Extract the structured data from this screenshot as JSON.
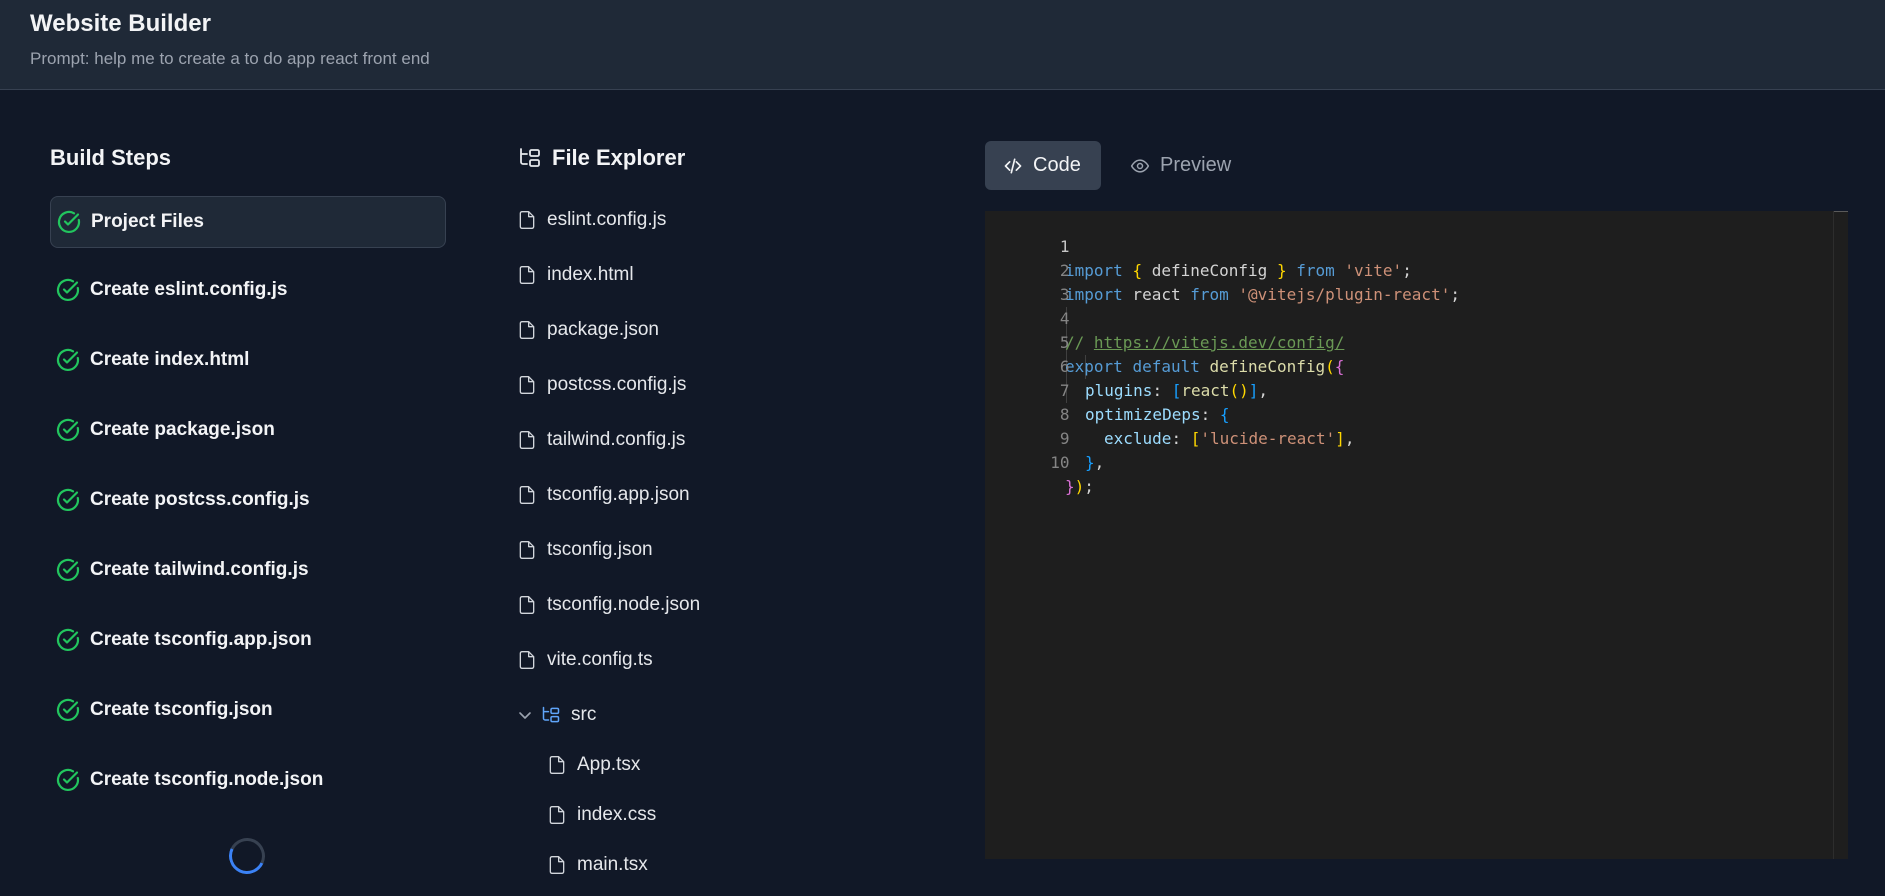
{
  "header": {
    "title": "Website Builder",
    "prompt": "Prompt: help me to create a to do app react front end"
  },
  "build_steps": {
    "title": "Build Steps",
    "items": [
      {
        "label": "Project Files",
        "status": "done",
        "active": true
      },
      {
        "label": "Create eslint.config.js",
        "status": "done"
      },
      {
        "label": "Create index.html",
        "status": "done"
      },
      {
        "label": "Create package.json",
        "status": "done"
      },
      {
        "label": "Create postcss.config.js",
        "status": "done"
      },
      {
        "label": "Create tailwind.config.js",
        "status": "done"
      },
      {
        "label": "Create tsconfig.app.json",
        "status": "done"
      },
      {
        "label": "Create tsconfig.json",
        "status": "done"
      },
      {
        "label": "Create tsconfig.node.json",
        "status": "done"
      }
    ]
  },
  "file_explorer": {
    "title": "File Explorer",
    "files": [
      "eslint.config.js",
      "index.html",
      "package.json",
      "postcss.config.js",
      "tailwind.config.js",
      "tsconfig.app.json",
      "tsconfig.json",
      "tsconfig.node.json",
      "vite.config.ts"
    ],
    "folder": {
      "name": "src",
      "expanded": true,
      "files": [
        "App.tsx",
        "index.css",
        "main.tsx"
      ]
    }
  },
  "tabs": {
    "code_label": "Code",
    "preview_label": "Preview",
    "active": "code"
  },
  "editor": {
    "current_line": 1,
    "lines": [
      {
        "n": "1",
        "t1": "import",
        "t2": " ",
        "t3": "{",
        "t4": " defineConfig ",
        "t5": "}",
        "t6": " ",
        "t7": "from",
        "t8": " ",
        "t9": "'vite'",
        "t10": ";"
      },
      {
        "n": "2",
        "t1": "import",
        "t2": " react ",
        "t3": "from",
        "t4": " ",
        "t5": "'@vitejs/plugin-react'",
        "t6": ";"
      },
      {
        "n": "3"
      },
      {
        "n": "4",
        "t1": "// ",
        "t2": "https://vitejs.dev/config/"
      },
      {
        "n": "5",
        "t1": "export",
        "t2": " ",
        "t3": "default",
        "t4": " ",
        "t5": "defineConfig",
        "t6": "(",
        "t7": "{"
      },
      {
        "n": "6",
        "t1": "plugins",
        "t2": ": ",
        "t3": "[",
        "t4": "react",
        "t5": "()",
        "t6": "]",
        "t7": ","
      },
      {
        "n": "7",
        "t1": "optimizeDeps",
        "t2": ": ",
        "t3": "{"
      },
      {
        "n": "8",
        "t1": "exclude",
        "t2": ": ",
        "t3": "[",
        "t4": "'lucide-react'",
        "t5": "]",
        "t6": ","
      },
      {
        "n": "9",
        "t1": "}",
        "t2": ","
      },
      {
        "n": "10",
        "t1": "}",
        "t2": ")",
        "t3": ";"
      }
    ]
  },
  "colors": {
    "background": "#111827",
    "header": "#1f2937",
    "success": "#22c55e",
    "folder_icon": "#60a5fa",
    "spinner": "#3b82f6",
    "editor_bg": "#1e1e1e"
  },
  "icons": {
    "step_status": "check-circle-icon",
    "file": "file-icon",
    "folder": "folder-tree-icon",
    "code_tab": "code-icon",
    "preview_tab": "eye-icon",
    "loading": "spinner-icon"
  }
}
